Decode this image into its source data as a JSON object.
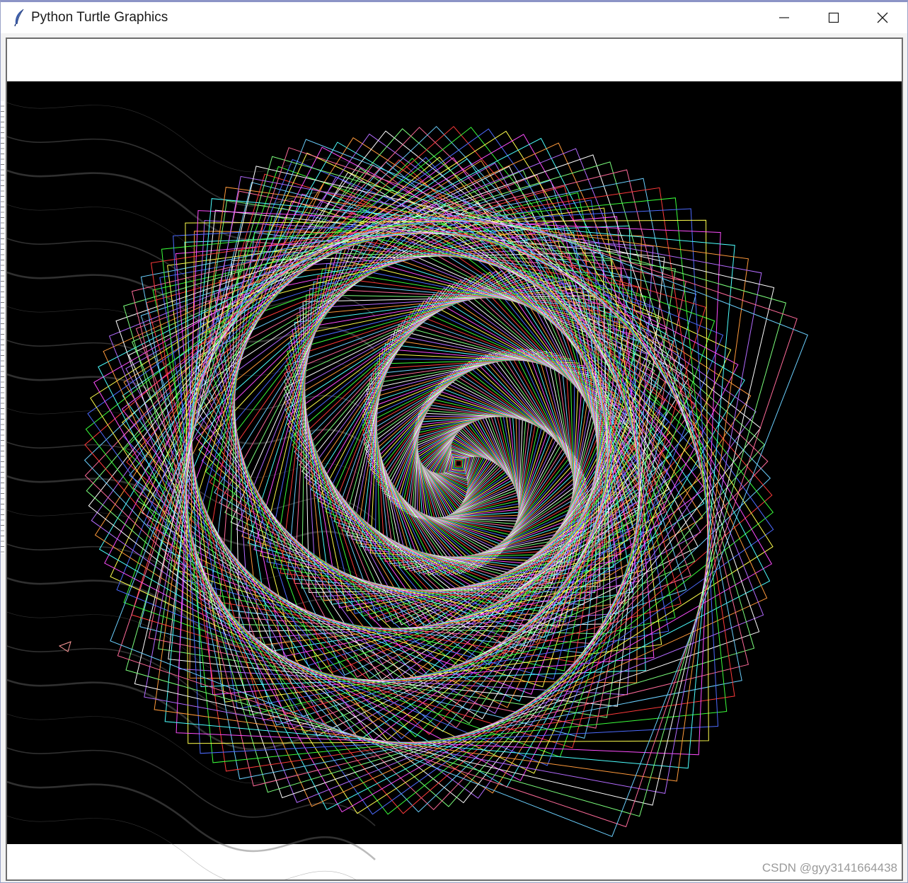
{
  "window": {
    "title": "Python Turtle Graphics",
    "icon": "feather-icon",
    "controls": [
      "minimize-icon",
      "maximize-icon",
      "close-icon"
    ]
  },
  "canvas": {
    "background": "#000000",
    "margin_color": "#ffffff",
    "pen_colors": [
      "#ff3b3b",
      "#3bff3b",
      "#4d6bff",
      "#ffff4d",
      "#ff4dff",
      "#4dffff",
      "#ff9a3b",
      "#b46bff",
      "#ffffff",
      "#7cff7c",
      "#ff6b9a",
      "#6bd0ff"
    ]
  },
  "watermark": "CSDN @gyy3141664438"
}
